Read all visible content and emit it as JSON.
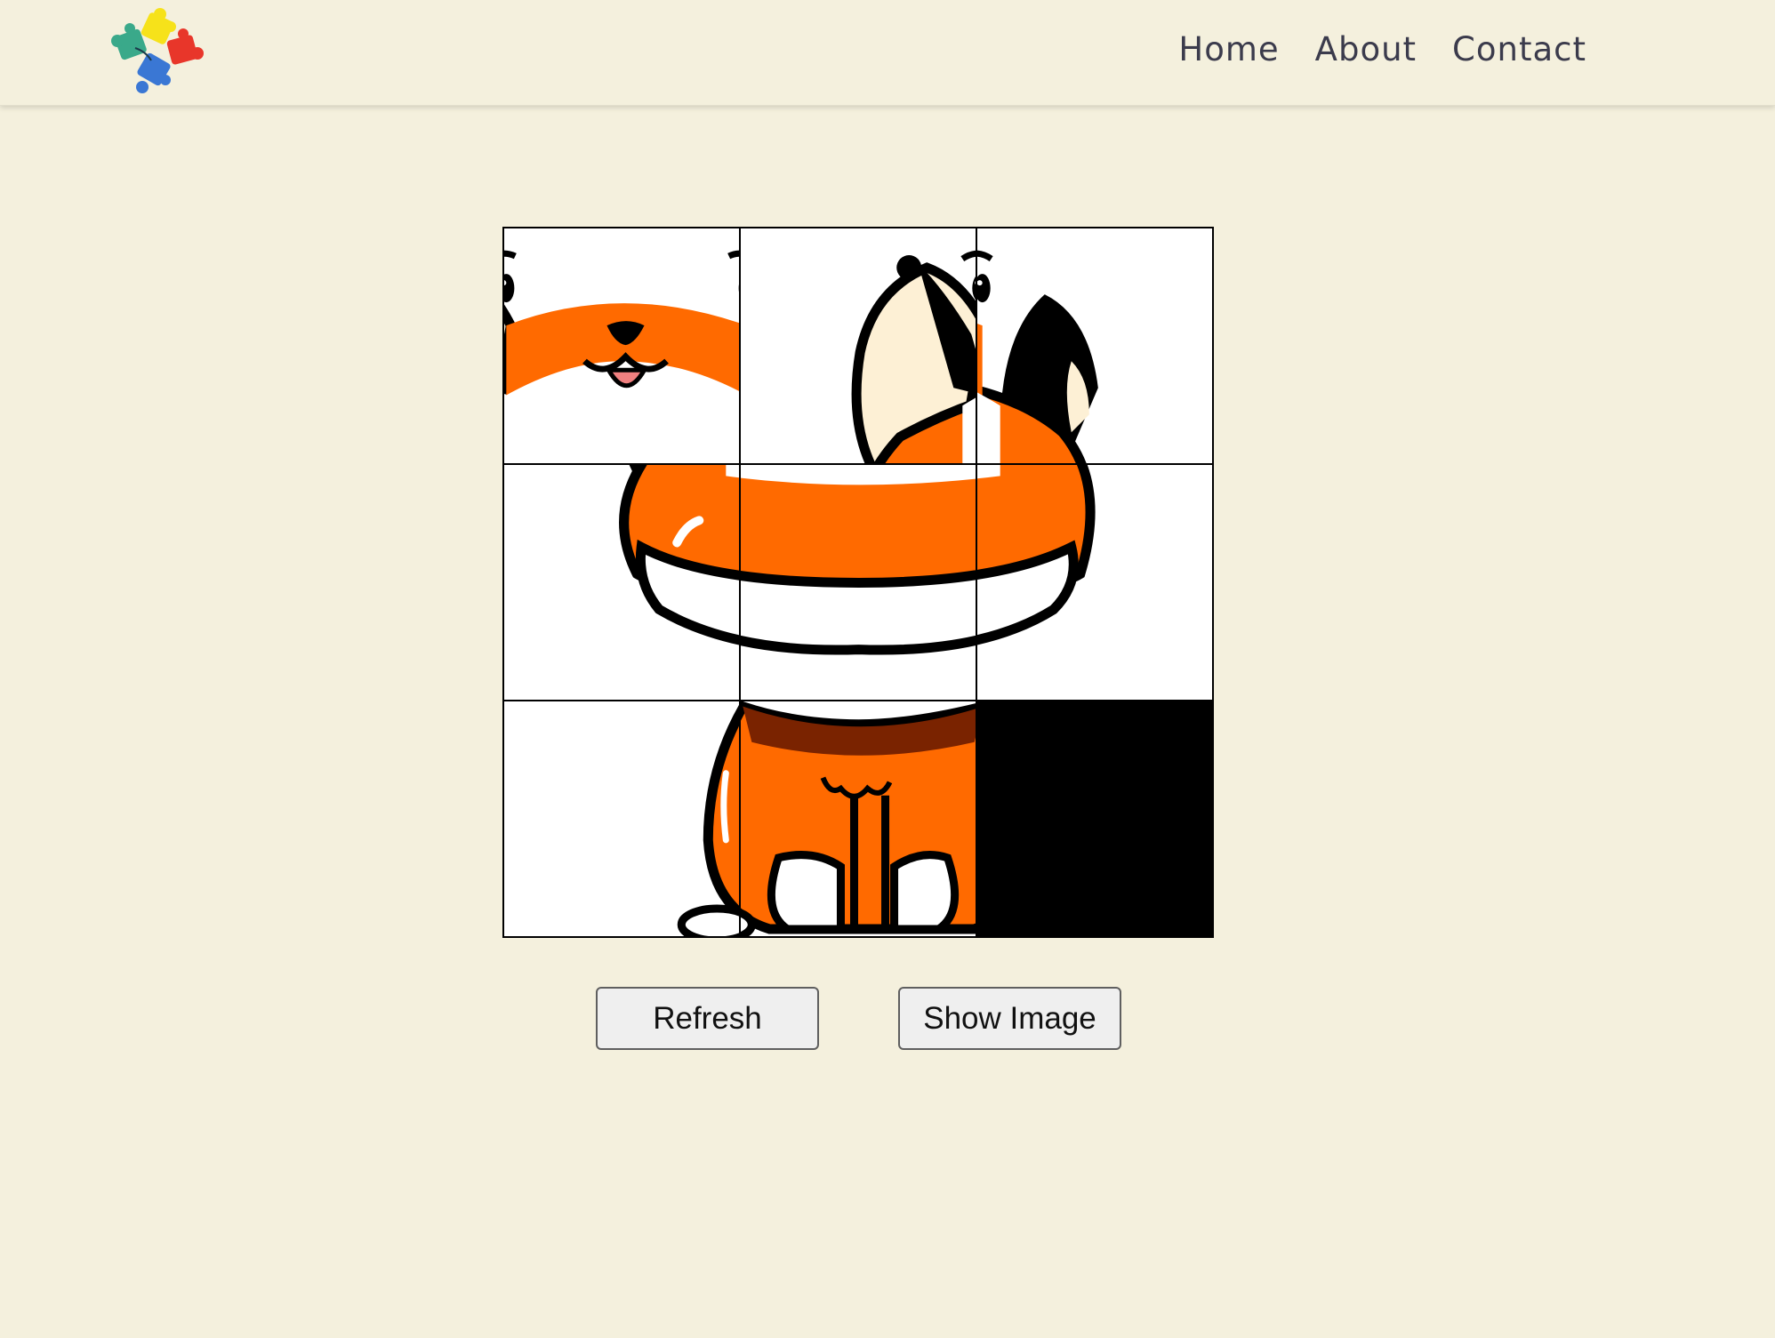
{
  "nav": {
    "logo": "puzzle-pieces-logo",
    "links": [
      "Home",
      "About",
      "Contact"
    ]
  },
  "puzzle": {
    "grid": "3x3",
    "tile_order": [
      2,
      1,
      3,
      4,
      5,
      6,
      7,
      8,
      null
    ],
    "empty_color": "#000000",
    "image": "cartoon-fox"
  },
  "buttons": {
    "refresh": "Refresh",
    "show_image": "Show Image"
  },
  "colors": {
    "background": "#f4f0dd",
    "fox_orange": "#ff6a00",
    "fox_cream": "#fdf0d5",
    "text": "#3b3b4c"
  }
}
